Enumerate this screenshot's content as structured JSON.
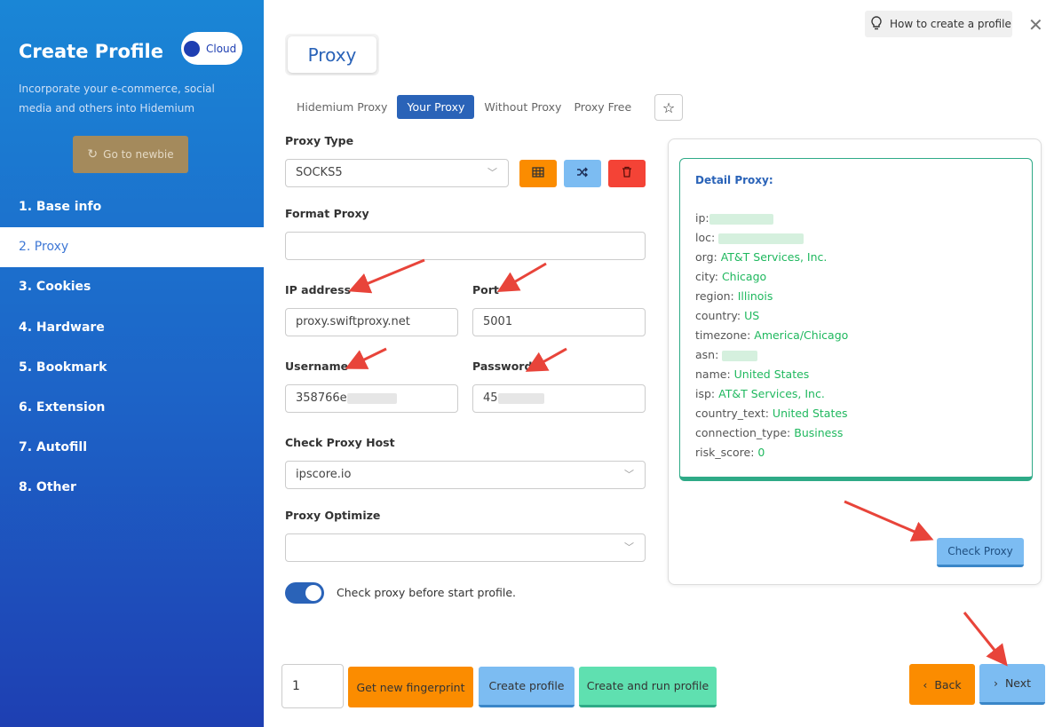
{
  "sidebar": {
    "title": "Create Profile",
    "cloud_label": "Cloud",
    "description": "Incorporate your e-commerce, social media and others into Hidemium",
    "newbie_button": "Go to newbie",
    "items": [
      {
        "label": "1. Base info"
      },
      {
        "label": "2. Proxy"
      },
      {
        "label": "3. Cookies"
      },
      {
        "label": "4. Hardware"
      },
      {
        "label": "5. Bookmark"
      },
      {
        "label": "6. Extension"
      },
      {
        "label": "7. Autofill"
      },
      {
        "label": "8. Other"
      }
    ]
  },
  "header": {
    "title": "Proxy",
    "help_label": "How to create a profile"
  },
  "tabs": [
    {
      "label": "Hidemium Proxy"
    },
    {
      "label": "Your Proxy"
    },
    {
      "label": "Without Proxy"
    },
    {
      "label": "Proxy Free"
    }
  ],
  "form": {
    "proxy_type_label": "Proxy Type",
    "proxy_type_value": "SOCKS5",
    "format_proxy_label": "Format Proxy",
    "format_proxy_value": "",
    "ip_label": "IP address",
    "ip_value": "proxy.swiftproxy.net",
    "port_label": "Port",
    "port_value": "5001",
    "username_label": "Username",
    "username_value": "358766e",
    "password_label": "Password",
    "password_value": "45",
    "check_host_label": "Check Proxy Host",
    "check_host_value": "ipscore.io",
    "optimize_label": "Proxy Optimize",
    "optimize_value": "",
    "toggle_label": "Check proxy before start profile."
  },
  "detail": {
    "title": "Detail Proxy:",
    "rows": [
      {
        "key": "ip:",
        "value": ""
      },
      {
        "key": "loc:",
        "value": ""
      },
      {
        "key": "org:",
        "value": "AT&T Services, Inc."
      },
      {
        "key": "city:",
        "value": "Chicago"
      },
      {
        "key": "region:",
        "value": "Illinois"
      },
      {
        "key": "country:",
        "value": "US"
      },
      {
        "key": "timezone:",
        "value": "America/Chicago"
      },
      {
        "key": "asn:",
        "value": ""
      },
      {
        "key": "name:",
        "value": "United States"
      },
      {
        "key": "isp:",
        "value": "AT&T Services, Inc."
      },
      {
        "key": "country_text:",
        "value": "United States"
      },
      {
        "key": "connection_type:",
        "value": "Business"
      },
      {
        "key": "risk_score:",
        "value": "0"
      }
    ],
    "check_button": "Check Proxy"
  },
  "footer": {
    "count_value": "1",
    "fingerprint_button": "Get new fingerprint",
    "create_button": "Create profile",
    "create_run_button": "Create and run profile",
    "back_button": "Back",
    "next_button": "Next"
  },
  "colors": {
    "accent": "#2a63b8",
    "orange": "#fb8c00",
    "blue_light": "#7cbcf2",
    "green_light": "#5fe0b0",
    "red": "#f44336",
    "value_green": "#1fb85e",
    "annotation_arrow": "#e8443a"
  }
}
